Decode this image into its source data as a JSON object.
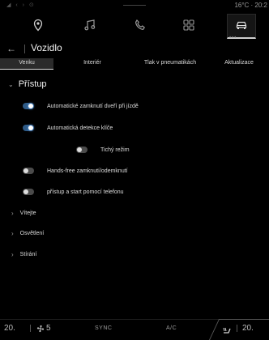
{
  "status_bar": {
    "left": "◢ ‹ › ⊙",
    "right": "16°C · 20:2"
  },
  "nav": {
    "icons": [
      "navigation-icon",
      "music-icon",
      "phone-icon",
      "apps-grid-icon",
      "car-icon"
    ],
    "active": "car-icon",
    "page_dots": "•••"
  },
  "title_bar": {
    "back": "←",
    "title": "Vozidlo"
  },
  "tabs": [
    {
      "label": "Venku",
      "active": true
    },
    {
      "label": "Interiér",
      "active": false
    },
    {
      "label": "Tlak v pneumatikách",
      "active": false
    },
    {
      "label": "Aktualizace",
      "active": false
    }
  ],
  "section": {
    "title": "Přístup",
    "expanded": true
  },
  "settings": [
    {
      "label": "Automatické zamknutí dveří při jízdě",
      "on": true
    },
    {
      "label": "Automatická detekce klíče",
      "on": true
    },
    {
      "label": "Tichý režim",
      "on": false
    },
    {
      "label": "Hands-free zamknutí/odemknutí",
      "on": false
    },
    {
      "label": "přístup a start pomocí telefonu",
      "on": false
    }
  ],
  "collapsed_sections": [
    "Vítejte",
    "Osvětlení",
    "Stírání"
  ],
  "climate": {
    "left_temp": "20.",
    "fan_level": "5",
    "sync": "SYNC",
    "ac": "A/C",
    "right_temp": "20."
  }
}
